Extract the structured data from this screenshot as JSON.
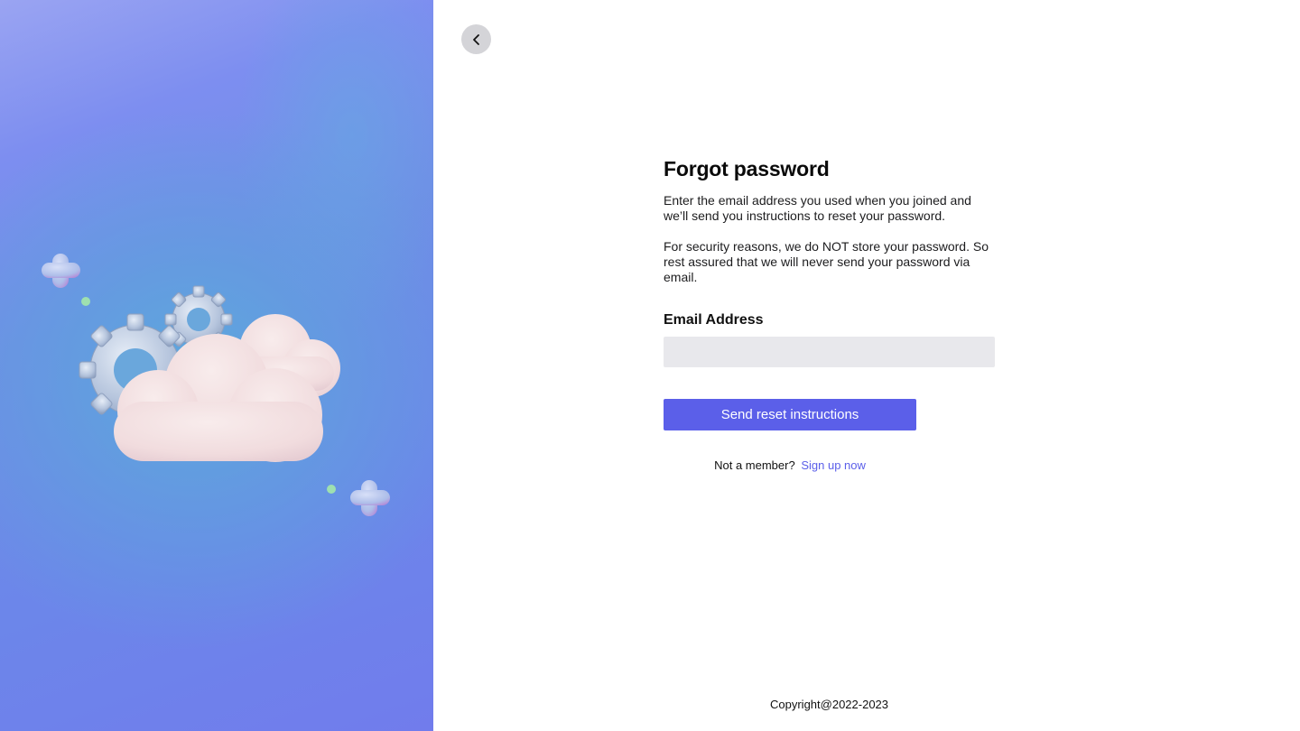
{
  "illustration": {
    "description_icon": "cloud-gears-illustration",
    "colors": {
      "cloud": "#f3e1e2",
      "gear": "#b9c8e0",
      "plus": "#b3c3ec",
      "dot": "#9ee0b0"
    }
  },
  "nav": {
    "back_icon": "chevron-left-icon"
  },
  "form": {
    "title": "Forgot password",
    "description_1": "Enter the email address you used when you joined and we’ll send you instructions to reset your password.",
    "description_2": "For security reasons, we do NOT store your password. So rest assured that we will never send your password via email.",
    "email_label": "Email Address",
    "email_value": "",
    "email_placeholder": "",
    "submit_label": "Send reset instructions"
  },
  "signup": {
    "prompt": "Not a member?",
    "link_label": "Sign up now"
  },
  "footer": {
    "copyright": "Copyright@2022-2023"
  },
  "colors": {
    "accent": "#5b5fe9",
    "input_bg": "#e8e8ec",
    "back_button_bg": "#d4d4d8"
  }
}
